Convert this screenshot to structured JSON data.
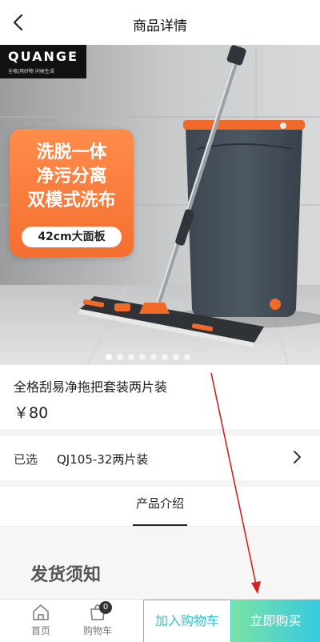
{
  "nav": {
    "title": "商品详情"
  },
  "hero": {
    "brand_name": "QUANGE",
    "brand_tagline": "全格|用好物 问候生活",
    "promo_lines": [
      "洗脱一体",
      "净污分离",
      "双模式洗布"
    ],
    "promo_pill": "42cm大面板",
    "dots_total": 8,
    "dots_active": 0
  },
  "product": {
    "name": "全格刮易净拖把套装两片装",
    "price": "￥80"
  },
  "spec": {
    "label": "已选",
    "value": "QJ105-32两片装"
  },
  "tabs": {
    "intro": "产品介绍"
  },
  "notice": {
    "title": "发货须知"
  },
  "tabbar": {
    "home_label": "首页",
    "cart_label": "购物车",
    "cart_badge": "0",
    "add_to_cart": "加入购物车",
    "buy_now": "立即购买"
  },
  "colors": {
    "accent": "#36c9e0",
    "promo": "#f46f2f",
    "annotation_arrow": "#d62020"
  }
}
